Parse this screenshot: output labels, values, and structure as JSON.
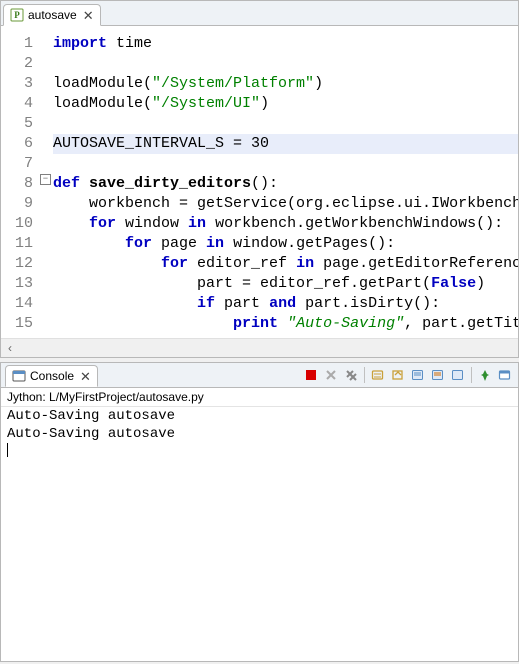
{
  "editor": {
    "tab_label": "autosave",
    "code_lines": [
      {
        "tokens": [
          {
            "t": "import",
            "c": "kw"
          },
          {
            "t": " time",
            "c": ""
          }
        ]
      },
      {
        "tokens": []
      },
      {
        "tokens": [
          {
            "t": "loadModule(",
            "c": ""
          },
          {
            "t": "\"/System/Platform\"",
            "c": "str"
          },
          {
            "t": ")",
            "c": ""
          }
        ]
      },
      {
        "tokens": [
          {
            "t": "loadModule(",
            "c": ""
          },
          {
            "t": "\"/System/UI\"",
            "c": "str"
          },
          {
            "t": ")",
            "c": ""
          }
        ]
      },
      {
        "tokens": []
      },
      {
        "hl": true,
        "tokens": [
          {
            "t": "AUTOSAVE_INTERVAL_S = ",
            "c": "cst"
          },
          {
            "t": "30",
            "c": "num"
          }
        ]
      },
      {
        "tokens": []
      },
      {
        "tokens": [
          {
            "t": "def ",
            "c": "kw"
          },
          {
            "t": "save_dirty_editors",
            "c": "fn"
          },
          {
            "t": "():",
            "c": ""
          }
        ]
      },
      {
        "tokens": [
          {
            "t": "    workbench = getService(org.eclipse.ui.IWorkbench",
            "c": ""
          }
        ]
      },
      {
        "tokens": [
          {
            "t": "    ",
            "c": ""
          },
          {
            "t": "for",
            "c": "kw"
          },
          {
            "t": " window ",
            "c": ""
          },
          {
            "t": "in",
            "c": "kw"
          },
          {
            "t": " workbench.getWorkbenchWindows():",
            "c": ""
          }
        ]
      },
      {
        "tokens": [
          {
            "t": "        ",
            "c": ""
          },
          {
            "t": "for",
            "c": "kw"
          },
          {
            "t": " page ",
            "c": ""
          },
          {
            "t": "in",
            "c": "kw"
          },
          {
            "t": " window.getPages():",
            "c": ""
          }
        ]
      },
      {
        "tokens": [
          {
            "t": "            ",
            "c": ""
          },
          {
            "t": "for",
            "c": "kw"
          },
          {
            "t": " editor_ref ",
            "c": ""
          },
          {
            "t": "in",
            "c": "kw"
          },
          {
            "t": " page.getEditorReferenc",
            "c": ""
          }
        ]
      },
      {
        "tokens": [
          {
            "t": "                part = editor_ref.getPart(",
            "c": ""
          },
          {
            "t": "False",
            "c": "kw"
          },
          {
            "t": ")",
            "c": ""
          }
        ]
      },
      {
        "tokens": [
          {
            "t": "                ",
            "c": ""
          },
          {
            "t": "if",
            "c": "kw"
          },
          {
            "t": " part ",
            "c": ""
          },
          {
            "t": "and",
            "c": "kw"
          },
          {
            "t": " part.isDirty():",
            "c": ""
          }
        ]
      },
      {
        "tokens": [
          {
            "t": "                    ",
            "c": ""
          },
          {
            "t": "print",
            "c": "kw"
          },
          {
            "t": " ",
            "c": ""
          },
          {
            "t": "\"Auto-Saving\"",
            "c": "stri"
          },
          {
            "t": ", part.getTit",
            "c": ""
          }
        ]
      }
    ],
    "line_numbers": [
      "1",
      "2",
      "3",
      "4",
      "5",
      "6",
      "7",
      "8",
      "9",
      "10",
      "11",
      "12",
      "13",
      "14",
      "15"
    ]
  },
  "console": {
    "tab_label": "Console",
    "subtitle": "Jython: L/MyFirstProject/autosave.py",
    "output_lines": [
      "Auto-Saving autosave",
      "Auto-Saving autosave"
    ]
  },
  "icons": {
    "file": "P",
    "console": "C"
  },
  "colors": {
    "accent": "#0000c0",
    "string": "#008000",
    "hl_bg": "#e8edfa"
  },
  "toolbar": {
    "terminate": "terminate",
    "remove_launch": "remove-launch",
    "remove_launch_disabled": true,
    "remove_all": "remove-all-terminated",
    "clear": "clear-console",
    "scroll_lock": "scroll-lock",
    "word_wrap": "word-wrap",
    "pin": "pin-console",
    "display": "display-selected",
    "open": "open-console",
    "min": "minimize",
    "max": "maximize"
  }
}
